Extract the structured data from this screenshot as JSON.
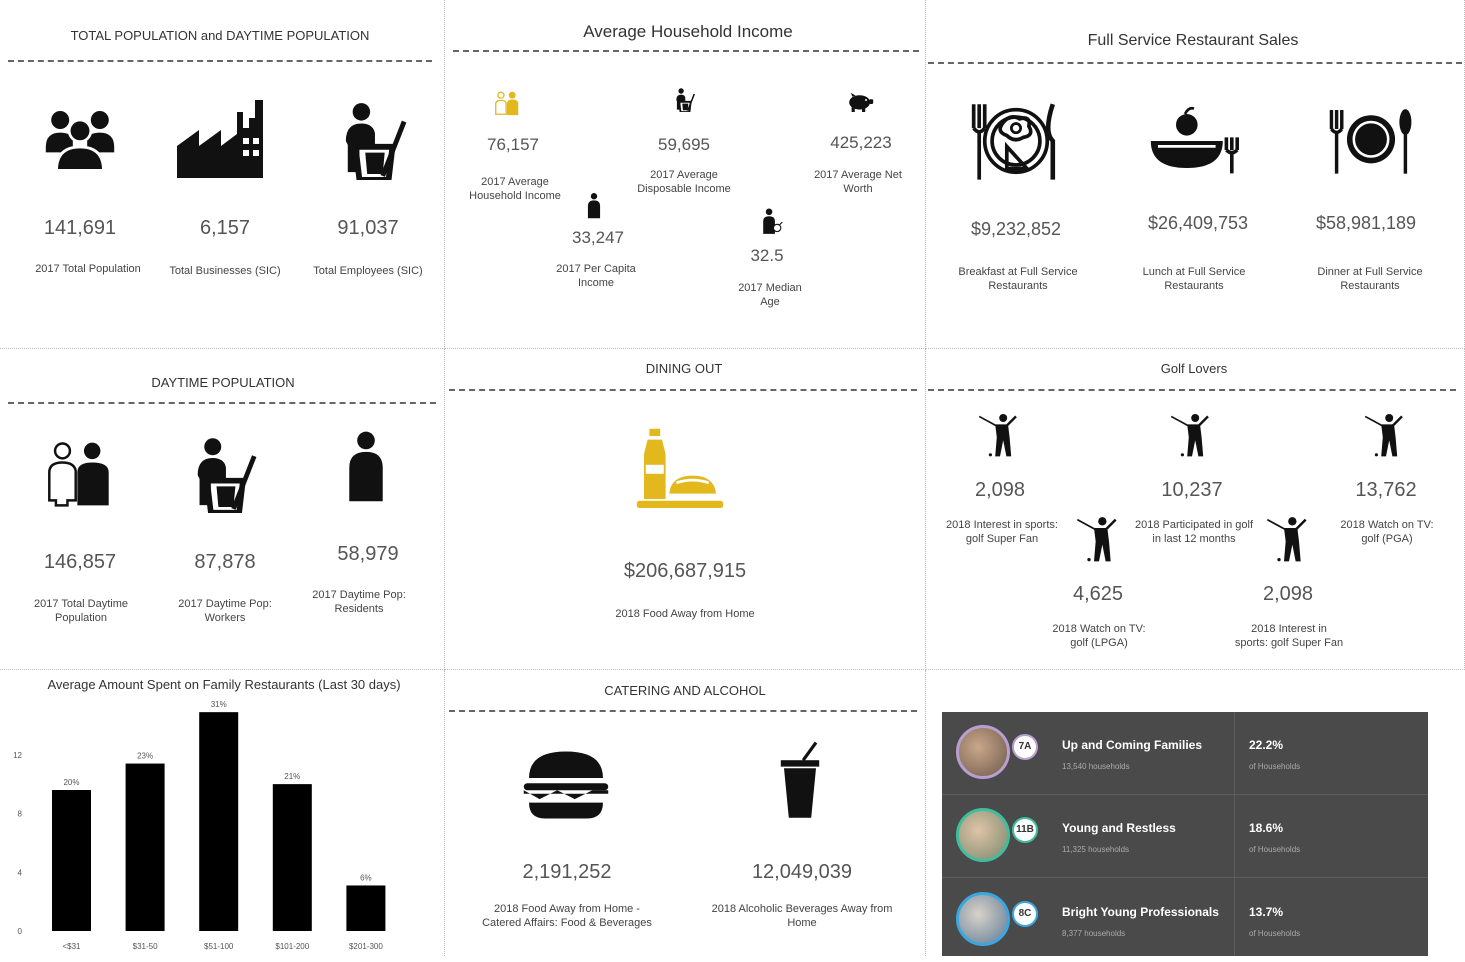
{
  "colors": {
    "accent": "#e3b81c",
    "icon": "#111111",
    "segment_bg": "#4a4a4a",
    "ring_7a": "#b89fd0",
    "ring_11b": "#3dbf9f",
    "ring_8c": "#3aa7e0"
  },
  "population": {
    "title": "TOTAL POPULATION and DAYTIME POPULATION",
    "items": [
      {
        "icon": "people-icon",
        "value": "141,691",
        "label": "2017 Total Population"
      },
      {
        "icon": "factory-icon",
        "value": "6,157",
        "label": "Total Businesses (SIC)"
      },
      {
        "icon": "worker-icon",
        "value": "91,037",
        "label": "Total Employees (SIC)"
      }
    ]
  },
  "income": {
    "title": "Average Household Income",
    "items": [
      {
        "icon": "household-icon",
        "value": "76,157",
        "label": "2017 Average Household Income"
      },
      {
        "icon": "worker-icon",
        "value": "59,695",
        "label": "2017 Average Disposable Income"
      },
      {
        "icon": "piggy-bank-icon",
        "value": "425,223",
        "label": "2017 Average Net Worth"
      },
      {
        "icon": "person-icon",
        "value": "33,247",
        "label": "2017 Per Capita Income"
      },
      {
        "icon": "age-icon",
        "value": "32.5",
        "label": "2017 Median Age"
      }
    ]
  },
  "restaurant": {
    "title": "Full Service Restaurant Sales",
    "items": [
      {
        "icon": "breakfast-plate-icon",
        "value": "$9,232,852",
        "label": "Breakfast at Full Service Restaurants"
      },
      {
        "icon": "lunch-bowl-icon",
        "value": "$26,409,753",
        "label": "Lunch at Full Service Restaurants"
      },
      {
        "icon": "dinner-plate-icon",
        "value": "$58,981,189",
        "label": "Dinner at Full Service Restaurants"
      }
    ]
  },
  "daytime": {
    "title": "DAYTIME POPULATION",
    "items": [
      {
        "icon": "couple-icon",
        "value": "146,857",
        "label": "2017 Total Daytime Population"
      },
      {
        "icon": "worker-icon",
        "value": "87,878",
        "label": "2017 Daytime Pop: Workers"
      },
      {
        "icon": "person-icon",
        "value": "58,979",
        "label": "2017 Daytime Pop: Residents"
      }
    ]
  },
  "dining": {
    "title": "DINING OUT",
    "icon": "wine-food-icon",
    "value": "$206,687,915",
    "label": "2018 Food Away from Home"
  },
  "golf": {
    "title": "Golf Lovers",
    "items": [
      {
        "icon": "golfer-icon",
        "value": "2,098",
        "label": "2018 Interest in sports: golf Super Fan"
      },
      {
        "icon": "golfer-icon",
        "value": "10,237",
        "label": "2018 Participated in golf in last 12 months"
      },
      {
        "icon": "golfer-icon",
        "value": "13,762",
        "label": "2018 Watch on TV: golf (PGA)"
      },
      {
        "icon": "golfer-icon",
        "value": "4,625",
        "label": "2018 Watch on TV: golf (LPGA)"
      },
      {
        "icon": "golfer-icon",
        "value": "2,098",
        "label": "2018 Interest in sports: golf Super Fan"
      }
    ]
  },
  "catering": {
    "title": "CATERING AND ALCOHOL",
    "items": [
      {
        "icon": "burger-icon",
        "value": "2,191,252",
        "label": "2018 Food Away from Home - Catered Affairs: Food & Beverages"
      },
      {
        "icon": "drink-cup-icon",
        "value": "12,049,039",
        "label": "2018 Alcoholic Beverages Away from Home"
      }
    ]
  },
  "chart_data": {
    "type": "bar",
    "title": "Average Amount Spent on Family Restaurants (Last 30 days)",
    "categories": [
      "<$31",
      "$31-50",
      "$51-100",
      "$101-200",
      "$201-300"
    ],
    "values": [
      9.6,
      11.4,
      14.9,
      10,
      3.1
    ],
    "data_labels": [
      "20%",
      "23%",
      "31%",
      "21%",
      "6%"
    ],
    "yticks": [
      "0",
      "4",
      "8",
      "12"
    ],
    "ylim": [
      0,
      16
    ],
    "grid": false,
    "bar_color": "#000000"
  },
  "segments": [
    {
      "code": "7A",
      "name": "Up and Coming Families",
      "households": "13,540 households",
      "pct": "22.2%",
      "pct_label": "of Households",
      "ring": "#b89fd0"
    },
    {
      "code": "11B",
      "name": "Young and Restless",
      "households": "11,325 households",
      "pct": "18.6%",
      "pct_label": "of Households",
      "ring": "#3dbf9f"
    },
    {
      "code": "8C",
      "name": "Bright Young Professionals",
      "households": "8,377 households",
      "pct": "13.7%",
      "pct_label": "of Households",
      "ring": "#3aa7e0"
    }
  ]
}
